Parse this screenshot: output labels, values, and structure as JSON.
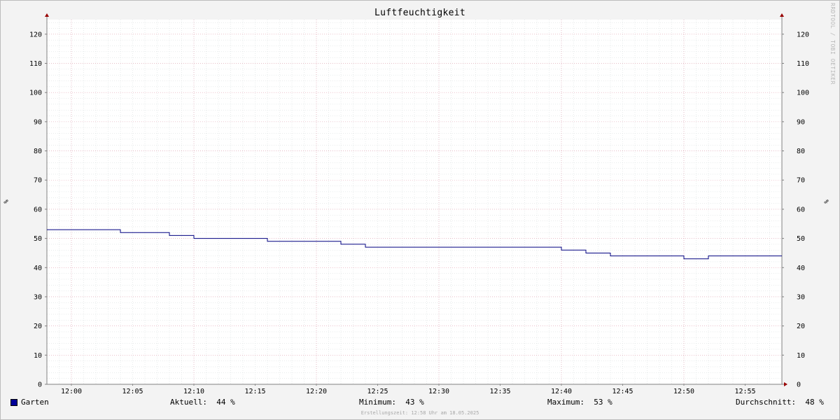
{
  "chart_data": {
    "type": "line",
    "title": "Luftfeuchtigkeit",
    "ylabel": "%",
    "ylim": [
      0,
      125
    ],
    "yticks": [
      0,
      10,
      20,
      30,
      40,
      50,
      60,
      70,
      80,
      90,
      100,
      110,
      120
    ],
    "xrange_min": [
      "11:58",
      "12:58"
    ],
    "xtick_labels": [
      "12:00",
      "12:05",
      "12:10",
      "12:15",
      "12:20",
      "12:25",
      "12:30",
      "12:35",
      "12:40",
      "12:45",
      "12:50",
      "12:55"
    ],
    "grid": true,
    "series": [
      {
        "name": "Garten",
        "color": "#000080",
        "step": true,
        "points": [
          {
            "t": "11:58",
            "v": 53
          },
          {
            "t": "12:04",
            "v": 52
          },
          {
            "t": "12:08",
            "v": 51
          },
          {
            "t": "12:10",
            "v": 50
          },
          {
            "t": "12:16",
            "v": 49
          },
          {
            "t": "12:22",
            "v": 48
          },
          {
            "t": "12:24",
            "v": 47
          },
          {
            "t": "12:40",
            "v": 46
          },
          {
            "t": "12:42",
            "v": 45
          },
          {
            "t": "12:44",
            "v": 44
          },
          {
            "t": "12:50",
            "v": 43
          },
          {
            "t": "12:52",
            "v": 44
          },
          {
            "t": "12:58",
            "v": 44
          }
        ]
      }
    ]
  },
  "watermark": "RRDTOOL / TOBI OETIKER",
  "legend": {
    "series_name": "Garten",
    "swatch_color": "#000099",
    "current": "Aktuell:  44 %",
    "minimum": "Minimum:  43 %",
    "maximum": "Maximum:  53 %",
    "average": "Durchschnitt:  48 %"
  },
  "footer": "Erstellungszeit: 12:58 Uhr am 18.05.2025",
  "colors": {
    "background": "#f3f3f3",
    "canvas": "#ffffff",
    "major_grid": "#e5a0b0",
    "minor_grid": "#d0d8d8",
    "line": "#000080",
    "axis": "#808080",
    "arrow": "#990000"
  }
}
